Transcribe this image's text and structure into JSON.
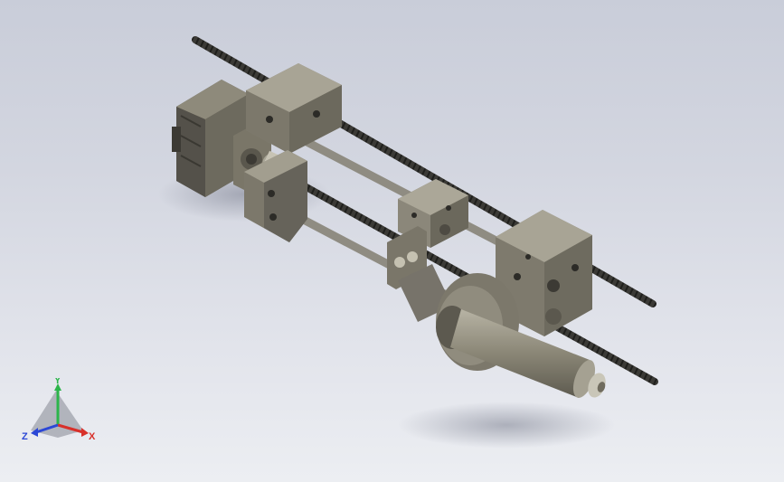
{
  "viewport": {
    "background_top": "#c9cdd9",
    "background_bottom": "#eceef2"
  },
  "model": {
    "body_color": "#807c6d",
    "body_dark": "#5d5a4f",
    "body_light": "#a19d8e",
    "screw_color": "#3b3a36",
    "rod_color": "#8a877d"
  },
  "triad": {
    "x_label": "X",
    "y_label": "Y",
    "z_label": "Z",
    "x_color": "#d8302a",
    "y_color": "#2cb54a",
    "z_color": "#2b47d6"
  }
}
